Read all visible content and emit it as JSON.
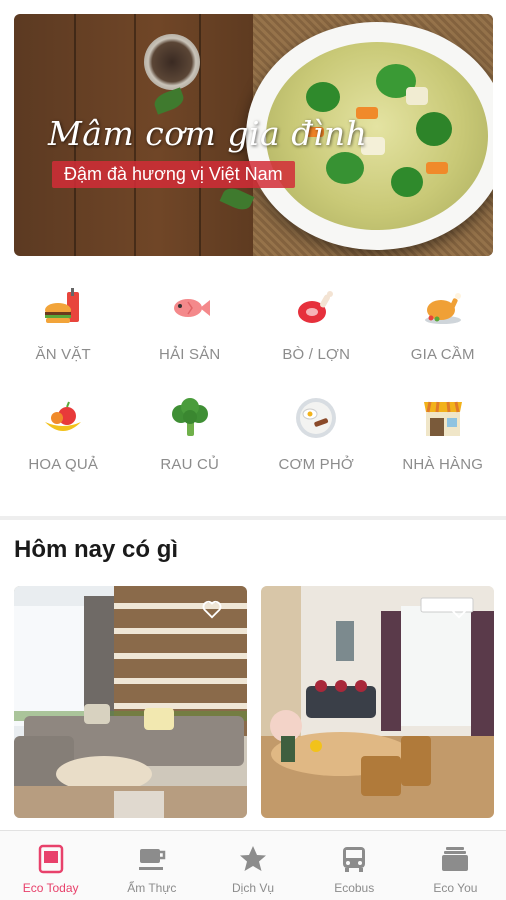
{
  "banner": {
    "title": "Mâm cơm gia đình",
    "subtitle": "Đậm đà hương vị Việt Nam"
  },
  "categories": [
    {
      "label": "ĂN VẶT",
      "icon": "fastfood-icon"
    },
    {
      "label": "HẢI SẢN",
      "icon": "fish-icon"
    },
    {
      "label": "BÒ / LỢN",
      "icon": "meat-icon"
    },
    {
      "label": "GIA CẦM",
      "icon": "roast-chicken-icon"
    },
    {
      "label": "HOA QUẢ",
      "icon": "fruit-icon"
    },
    {
      "label": "RAU CỦ",
      "icon": "broccoli-icon"
    },
    {
      "label": "CƠM PHỞ",
      "icon": "rice-plate-icon"
    },
    {
      "label": "NHÀ HÀNG",
      "icon": "restaurant-icon"
    }
  ],
  "section": {
    "title": "Hôm nay có gì"
  },
  "nav": {
    "items": [
      {
        "label": "Eco Today",
        "icon": "today-icon",
        "active": true
      },
      {
        "label": "Ẩm Thực",
        "icon": "coffee-cup-icon",
        "active": false
      },
      {
        "label": "Dịch Vụ",
        "icon": "star-icon",
        "active": false
      },
      {
        "label": "Ecobus",
        "icon": "bus-icon",
        "active": false
      },
      {
        "label": "Eco You",
        "icon": "wallet-icon",
        "active": false
      }
    ]
  },
  "colors": {
    "accent": "#e8416b",
    "muted": "#8c8c8c",
    "banner_red": "#d22d37"
  }
}
